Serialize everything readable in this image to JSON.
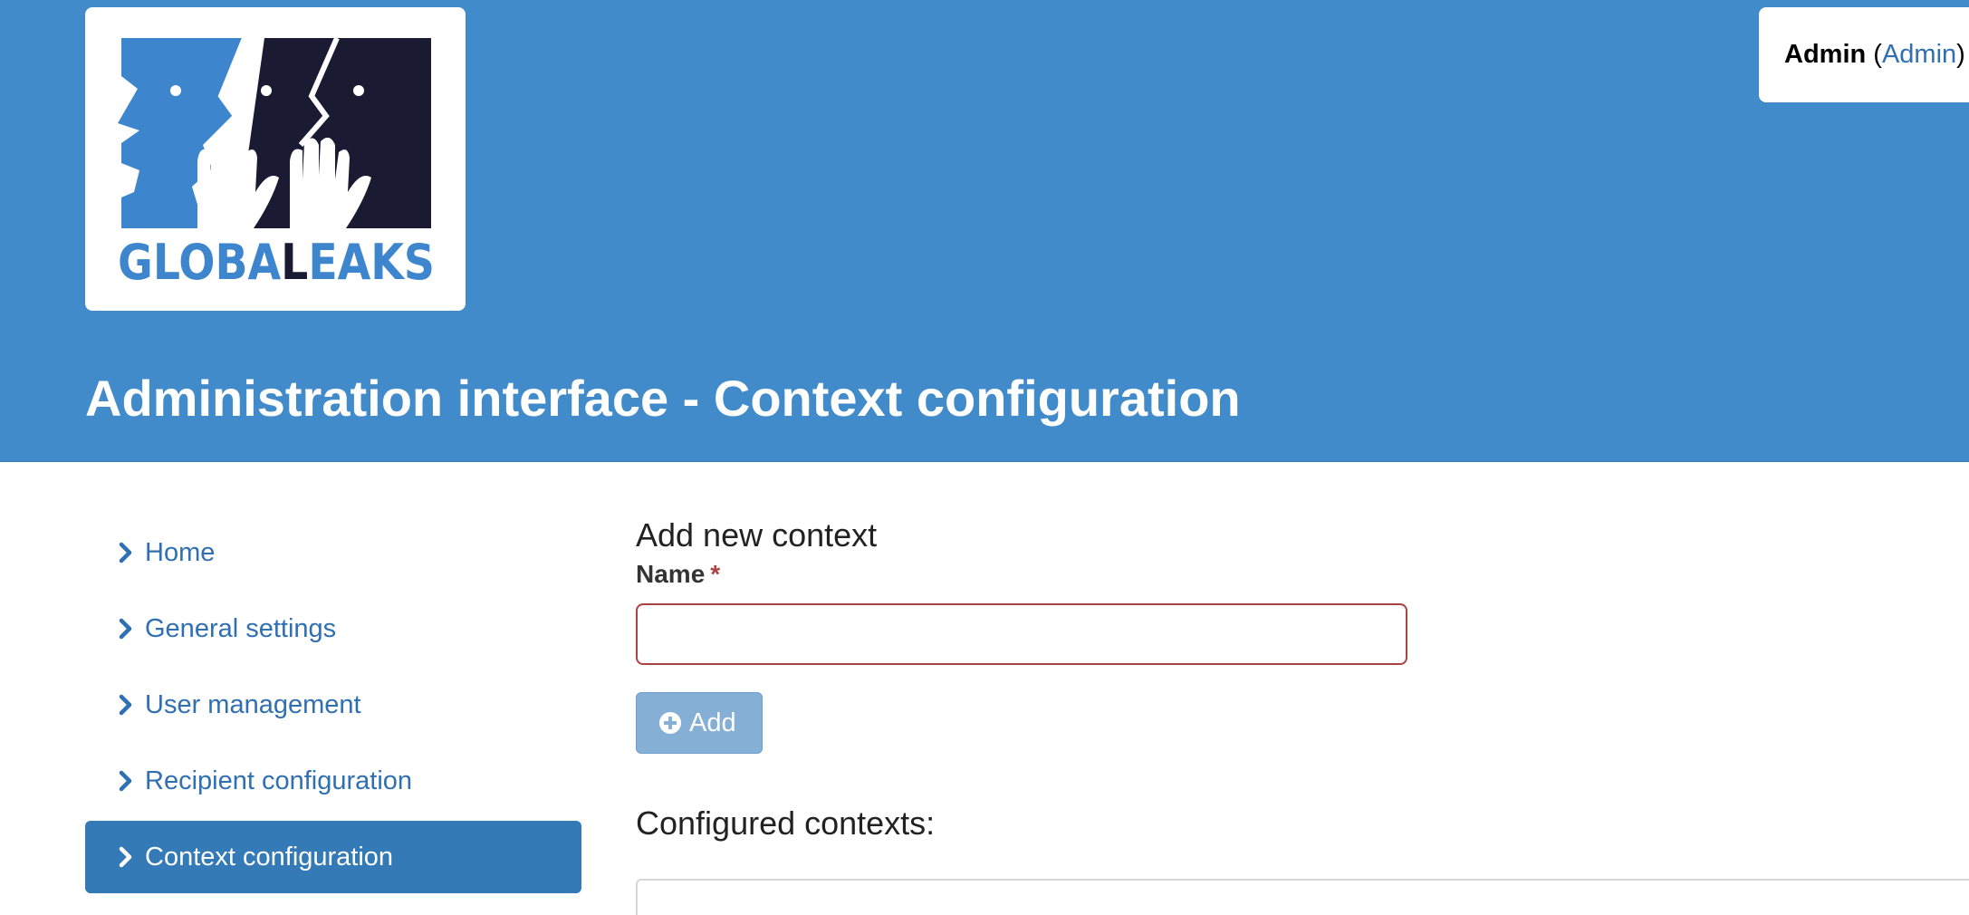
{
  "brand": {
    "logo_text": "GLOBALEAKS",
    "colors": {
      "header_blue": "#428bca",
      "nav_active": "#337ab7",
      "link_blue": "#2f6fb2",
      "logo_dark": "#1a1b33",
      "error_red": "#a94442"
    }
  },
  "header": {
    "page_title": "Administration interface - Context configuration",
    "user": {
      "name": "Admin",
      "role_link": "Admin",
      "open_paren": "(",
      "close_paren": ")",
      "separator": "|"
    }
  },
  "sidebar": {
    "items": [
      {
        "label": "Home",
        "icon": "chevron-right-icon",
        "active": false
      },
      {
        "label": "General settings",
        "icon": "chevron-right-icon",
        "active": false
      },
      {
        "label": "User management",
        "icon": "chevron-right-icon",
        "active": false
      },
      {
        "label": "Recipient configuration",
        "icon": "chevron-right-icon",
        "active": false
      },
      {
        "label": "Context configuration",
        "icon": "chevron-right-icon",
        "active": true
      }
    ]
  },
  "main": {
    "add_section_title": "Add new context",
    "name_label": "Name",
    "required_marker": "*",
    "name_value": "",
    "add_button_label": "Add",
    "add_button_icon": "plus-circle-icon",
    "configured_title": "Configured contexts:"
  }
}
